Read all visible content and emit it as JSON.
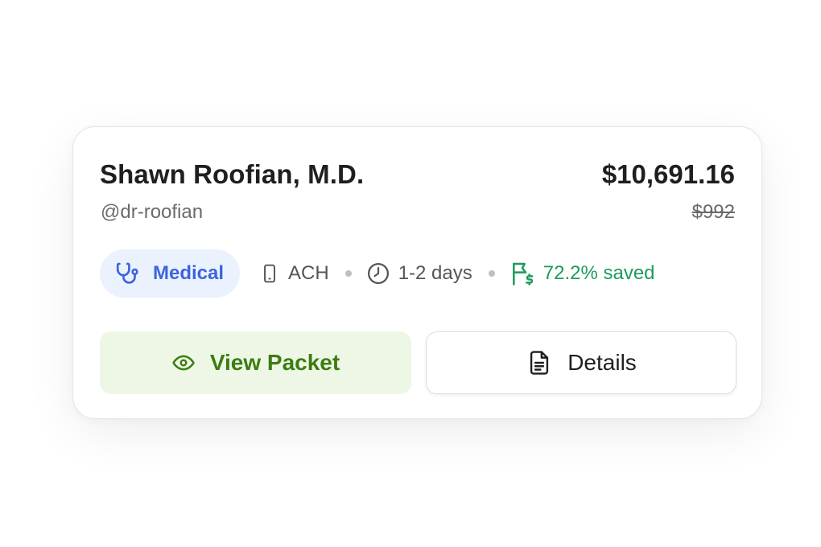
{
  "provider": {
    "name": "Shawn Roofian, M.D.",
    "handle": "@dr-roofian"
  },
  "payment": {
    "amount": "$10,691.16",
    "original_amount": "$992"
  },
  "meta": {
    "category": {
      "label": "Medical",
      "icon": "stethoscope-icon"
    },
    "method": {
      "label": "ACH",
      "icon": "phone-icon"
    },
    "timing": {
      "label": "1-2 days",
      "icon": "clock-icon"
    },
    "savings": {
      "label": "72.2% saved",
      "icon": "flag-dollar-icon"
    }
  },
  "actions": {
    "view_packet": {
      "label": "View Packet",
      "icon": "eye-icon"
    },
    "details": {
      "label": "Details",
      "icon": "document-icon"
    }
  },
  "colors": {
    "category_accent": "#3e63dd",
    "category_bg": "#eaf3fd",
    "savings": "#1e9a5c",
    "primary_text": "#3b7d12",
    "primary_bg": "#eef7e6"
  }
}
